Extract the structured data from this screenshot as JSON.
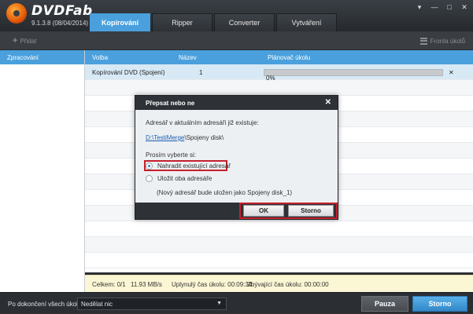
{
  "app": {
    "brand": "DVDFab",
    "version": "9.1.3.8 (08/04/2014)"
  },
  "tabs": [
    {
      "label": "Kopírování",
      "active": true
    },
    {
      "label": "Ripper",
      "active": false
    },
    {
      "label": "Converter",
      "active": false
    },
    {
      "label": "Vytváření",
      "active": false
    }
  ],
  "toolbar": {
    "add_label": "Přidat",
    "queue_label": "Fronta úkolů"
  },
  "left_panel": {
    "header": "Zpracování"
  },
  "table": {
    "columns": [
      "Volba",
      "Název",
      "Plánovač úkolu"
    ],
    "rows": [
      {
        "option": "Kopírování DVD (Spojení)",
        "name": "1",
        "progress_text": "0%",
        "progress": 0.0
      }
    ]
  },
  "status": {
    "total": "Celkem: 0/1",
    "speed": "11.93 MB/s",
    "elapsed": "Uplynulý čas úkolu: 00:09:34",
    "remaining": "Zbývající čas úkolu: 00:00:00"
  },
  "footer": {
    "label": "Po dokončení všech úkolů:",
    "select_value": "Nedělat nic",
    "pause_label": "Pauza",
    "stop_label": "Storno"
  },
  "dialog": {
    "title": "Přepsat nebo ne",
    "message": "Adresář v aktuálním adresáři již existuje:",
    "path_link": "D:\\TestiMerge",
    "path_rest": "\\Spojeny disk\\",
    "prompt": "Prosím vyberte si:",
    "option_replace": "Nahradit existující adresář",
    "option_keep": "Uložit oba adresáře",
    "note": "(Nový adresář bude uložen jako Spojeny disk_1)",
    "ok_label": "OK",
    "cancel_label": "Storno"
  },
  "colors": {
    "accent": "#4aa0dc",
    "highlight": "#c4202b",
    "status_bg": "#fbf6d4"
  },
  "icons": [
    "disc-logo-icon",
    "plus-icon",
    "queue-list-icon",
    "close-icon",
    "radio-icon",
    "chevron-down-icon"
  ]
}
